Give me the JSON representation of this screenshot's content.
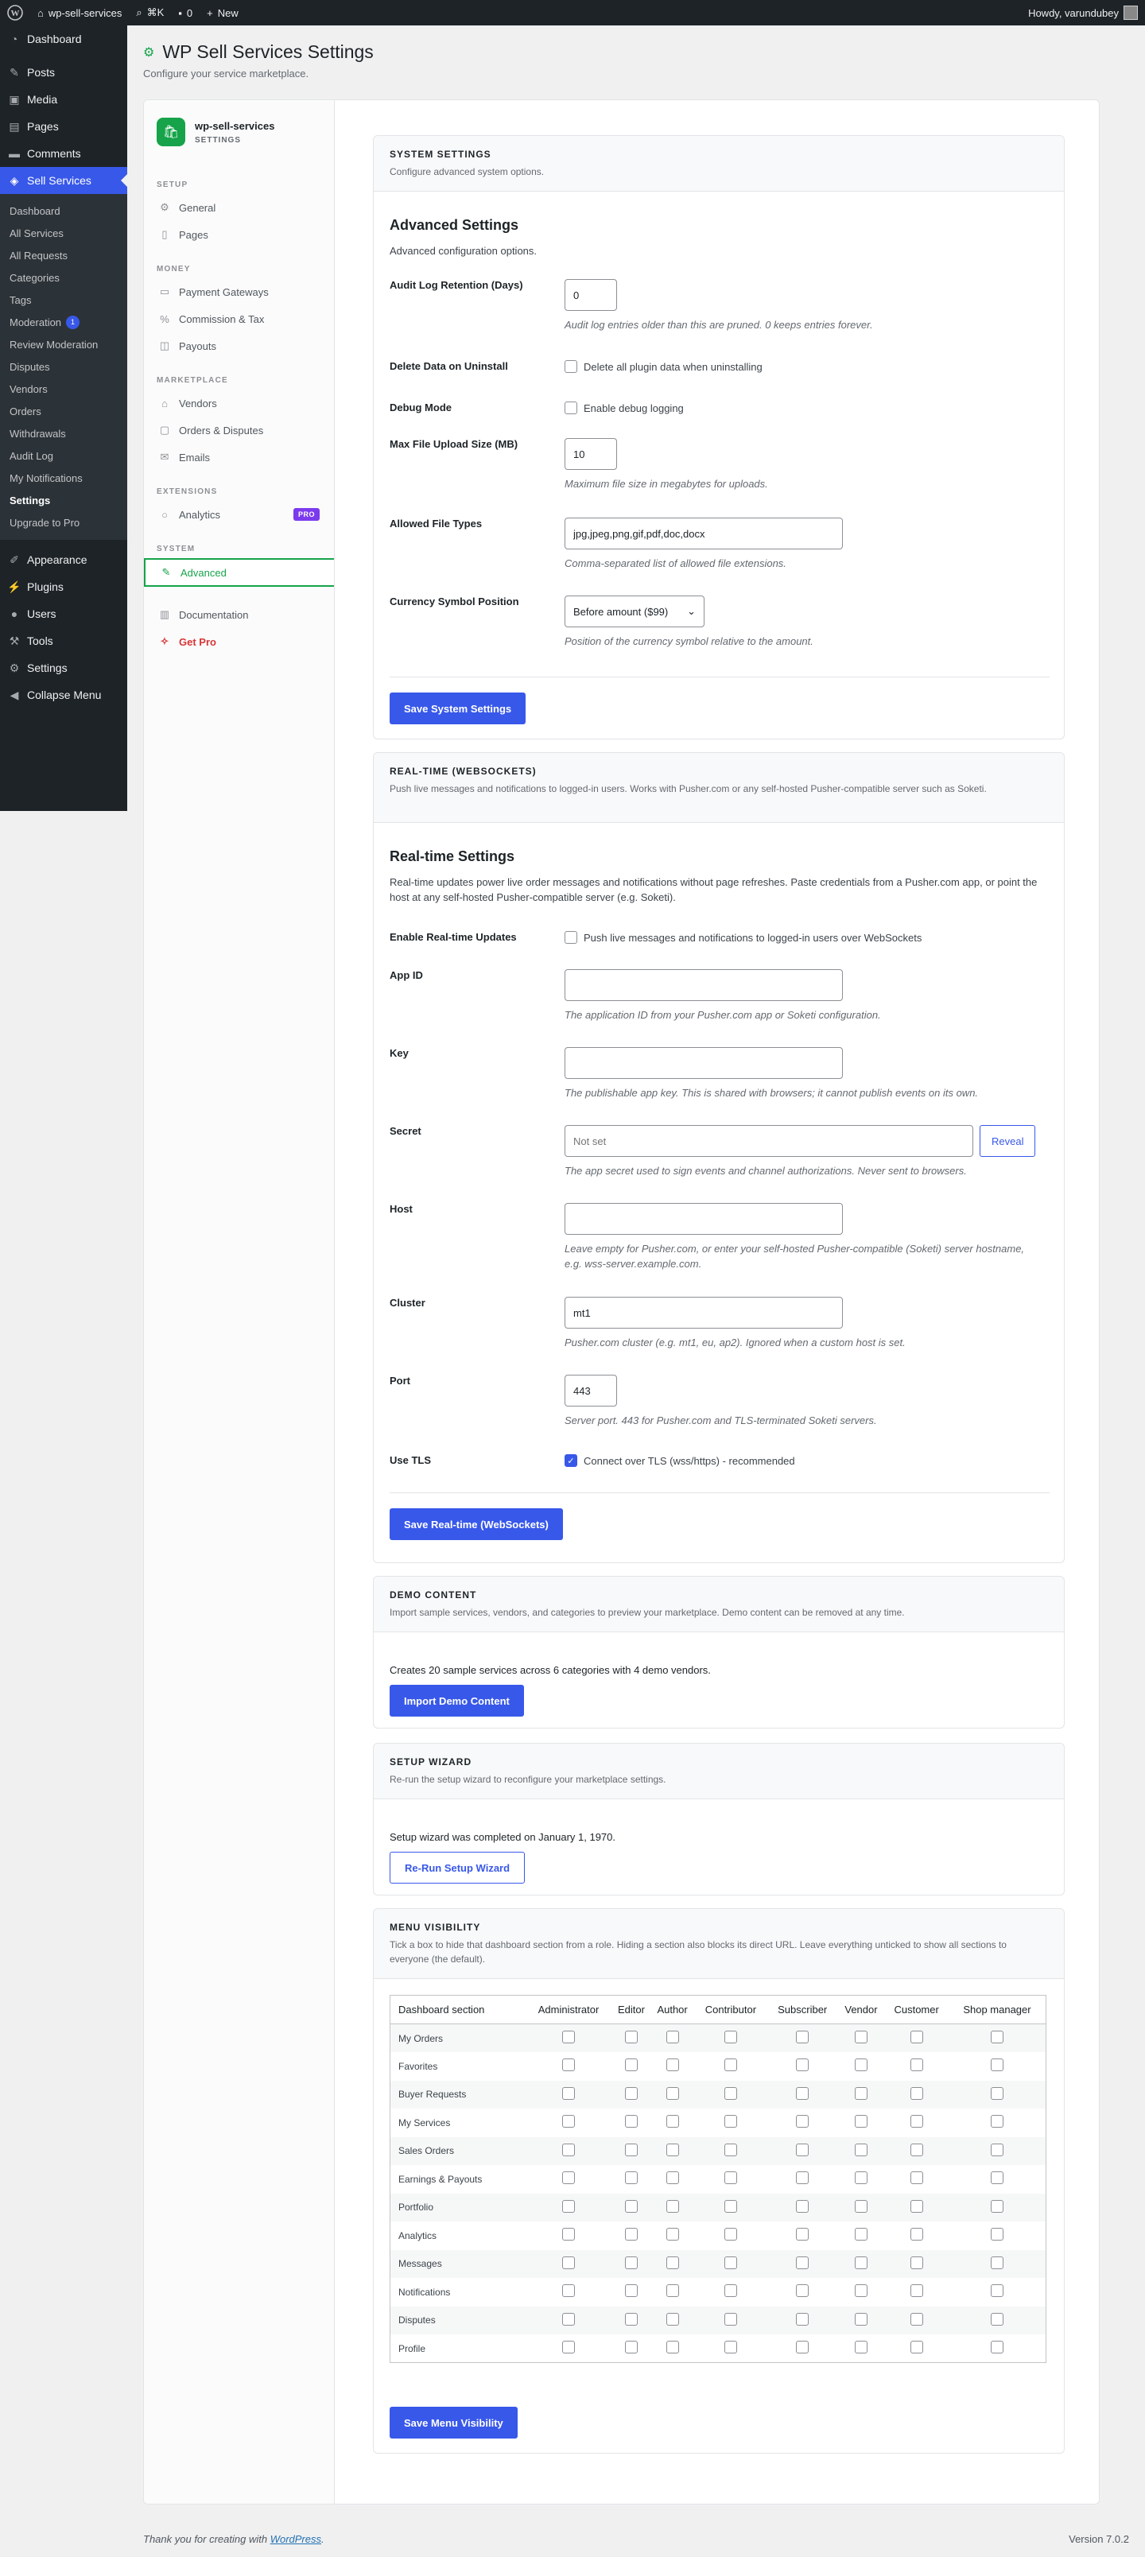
{
  "adminbar": {
    "site": "wp-sell-services",
    "shortcut": "⌘K",
    "comments": "0",
    "new": "New",
    "howdy": "Howdy, varundubey"
  },
  "menu": {
    "dashboard": "Dashboard",
    "posts": "Posts",
    "media": "Media",
    "pages": "Pages",
    "comments": "Comments",
    "sell_services": "Sell Services",
    "sub": [
      {
        "label": "Dashboard"
      },
      {
        "label": "All Services"
      },
      {
        "label": "All Requests"
      },
      {
        "label": "Categories"
      },
      {
        "label": "Tags"
      },
      {
        "label": "Moderation",
        "badge": "1"
      },
      {
        "label": "Review Moderation"
      },
      {
        "label": "Disputes"
      },
      {
        "label": "Vendors"
      },
      {
        "label": "Orders"
      },
      {
        "label": "Withdrawals"
      },
      {
        "label": "Audit Log"
      },
      {
        "label": "My Notifications"
      },
      {
        "label": "Settings"
      },
      {
        "label": "Upgrade to Pro"
      }
    ],
    "appearance": "Appearance",
    "plugins": "Plugins",
    "users": "Users",
    "tools": "Tools",
    "settings": "Settings",
    "collapse": "Collapse Menu"
  },
  "page": {
    "title": "WP Sell Services Settings",
    "subtitle": "Configure your service marketplace."
  },
  "sidenav": {
    "brand": "wp-sell-services",
    "brand_sub": "SETTINGS",
    "setup": "SETUP",
    "general": "General",
    "pages": "Pages",
    "money": "MONEY",
    "gateways": "Payment Gateways",
    "commission": "Commission & Tax",
    "payouts": "Payouts",
    "marketplace": "MARKETPLACE",
    "vendors": "Vendors",
    "orders": "Orders & Disputes",
    "emails": "Emails",
    "extensions": "EXTENSIONS",
    "analytics": "Analytics",
    "pro_badge": "PRO",
    "system": "SYSTEM",
    "advanced": "Advanced",
    "documentation": "Documentation",
    "getpro": "Get Pro"
  },
  "system": {
    "header": "SYSTEM SETTINGS",
    "header_desc": "Configure advanced system options.",
    "title": "Advanced Settings",
    "desc": "Advanced configuration options.",
    "audit_label": "Audit Log Retention (Days)",
    "audit_value": "0",
    "audit_desc": "Audit log entries older than this are pruned. 0 keeps entries forever.",
    "delete_label": "Delete Data on Uninstall",
    "delete_text": "Delete all plugin data when uninstalling",
    "debug_label": "Debug Mode",
    "debug_text": "Enable debug logging",
    "upload_label": "Max File Upload Size (MB)",
    "upload_value": "10",
    "upload_desc": "Maximum file size in megabytes for uploads.",
    "types_label": "Allowed File Types",
    "types_value": "jpg,jpeg,png,gif,pdf,doc,docx",
    "types_desc": "Comma-separated list of allowed file extensions.",
    "currency_label": "Currency Symbol Position",
    "currency_value": "Before amount ($99)",
    "currency_desc": "Position of the currency symbol relative to the amount.",
    "save": "Save System Settings"
  },
  "realtime": {
    "header": "REAL-TIME (WEBSOCKETS)",
    "header_desc": "Push live messages and notifications to logged-in users. Works with Pusher.com or any self-hosted Pusher-compatible server such as Soketi.",
    "title": "Real-time Settings",
    "desc": "Real-time updates power live order messages and notifications without page refreshes. Paste credentials from a Pusher.com app, or point the host at any self-hosted Pusher-compatible server (e.g. Soketi).",
    "enable_label": "Enable Real-time Updates",
    "enable_text": "Push live messages and notifications to logged-in users over WebSockets",
    "appid_label": "App ID",
    "appid_desc": "The application ID from your Pusher.com app or Soketi configuration.",
    "key_label": "Key",
    "key_desc": "The publishable app key. This is shared with browsers; it cannot publish events on its own.",
    "secret_label": "Secret",
    "secret_placeholder": "Not set",
    "reveal": "Reveal",
    "secret_desc": "The app secret used to sign events and channel authorizations. Never sent to browsers.",
    "host_label": "Host",
    "host_desc": "Leave empty for Pusher.com, or enter your self-hosted Pusher-compatible (Soketi) server hostname, e.g. wss-server.example.com.",
    "cluster_label": "Cluster",
    "cluster_value": "mt1",
    "cluster_desc": "Pusher.com cluster (e.g. mt1, eu, ap2). Ignored when a custom host is set.",
    "port_label": "Port",
    "port_value": "443",
    "port_desc": "Server port. 443 for Pusher.com and TLS-terminated Soketi servers.",
    "tls_label": "Use TLS",
    "tls_text": "Connect over TLS (wss/https) - recommended",
    "save": "Save Real-time (WebSockets)"
  },
  "demo": {
    "header": "DEMO CONTENT",
    "header_desc": "Import sample services, vendors, and categories to preview your marketplace. Demo content can be removed at any time.",
    "text": "Creates 20 sample services across 6 categories with 4 demo vendors.",
    "button": "Import Demo Content"
  },
  "wizard": {
    "header": "SETUP WIZARD",
    "header_desc": "Re-run the setup wizard to reconfigure your marketplace settings.",
    "text": "Setup wizard was completed on January 1, 1970.",
    "button": "Re-Run Setup Wizard"
  },
  "visibility": {
    "header": "MENU VISIBILITY",
    "header_desc": "Tick a box to hide that dashboard section from a role. Hiding a section also blocks its direct URL. Leave everything unticked to show all sections to everyone (the default).",
    "columns": [
      "Dashboard section",
      "Administrator",
      "Editor",
      "Author",
      "Contributor",
      "Subscriber",
      "Vendor",
      "Customer",
      "Shop manager"
    ],
    "rows": [
      "My Orders",
      "Favorites",
      "Buyer Requests",
      "My Services",
      "Sales Orders",
      "Earnings & Payouts",
      "Portfolio",
      "Analytics",
      "Messages",
      "Notifications",
      "Disputes",
      "Profile"
    ],
    "save": "Save Menu Visibility"
  },
  "footer": {
    "thanks": "Thank you for creating with",
    "wp": "WordPress",
    "version": "Version 7.0.2"
  }
}
